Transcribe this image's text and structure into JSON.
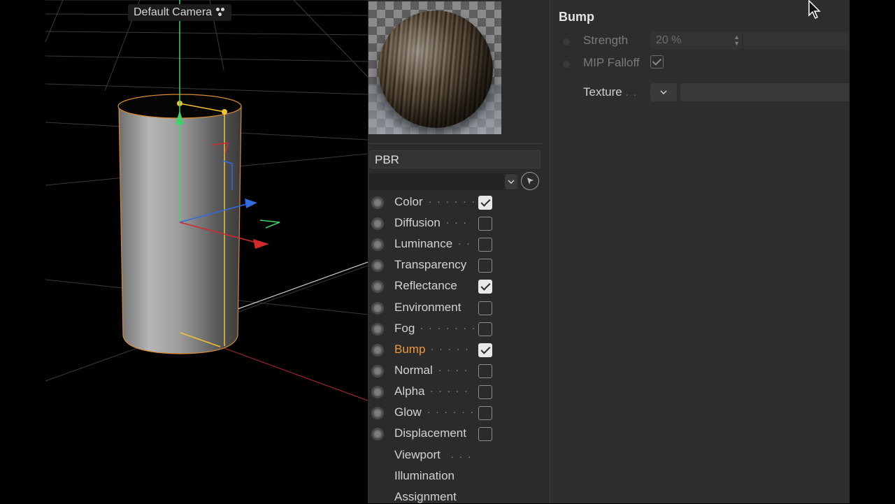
{
  "viewport": {
    "camera_label": "Default Camera"
  },
  "material": {
    "name": "PBR",
    "channels": [
      {
        "label": "Color",
        "checked": true,
        "dots": ". . . . . ."
      },
      {
        "label": "Diffusion",
        "checked": false,
        "dots": ". . ."
      },
      {
        "label": "Luminance",
        "checked": false,
        "dots": ". ."
      },
      {
        "label": "Transparency",
        "checked": false,
        "dots": ""
      },
      {
        "label": "Reflectance",
        "checked": true,
        "dots": ""
      },
      {
        "label": "Environment",
        "checked": false,
        "dots": ""
      },
      {
        "label": "Fog",
        "checked": false,
        "dots": ". . . . . . ."
      },
      {
        "label": "Bump",
        "checked": true,
        "dots": ". . . . . .",
        "active": true
      },
      {
        "label": "Normal",
        "checked": false,
        "dots": ". . . . ."
      },
      {
        "label": "Alpha",
        "checked": false,
        "dots": ". . . . . ."
      },
      {
        "label": "Glow",
        "checked": false,
        "dots": ". . . . . . ."
      },
      {
        "label": "Displacement",
        "checked": false,
        "dots": ""
      }
    ],
    "extra_items": [
      {
        "label": "Viewport",
        "dots": ". . ."
      },
      {
        "label": "Illumination",
        "dots": ""
      },
      {
        "label": "Assignment",
        "dots": ""
      }
    ]
  },
  "attributes": {
    "section_title": "Bump",
    "strength_label": "Strength",
    "strength_value": "20 %",
    "mip_falloff_label": "MIP Falloff",
    "mip_falloff_checked": true,
    "texture_label": "Texture",
    "texture_dots": ". ."
  },
  "colors": {
    "active_channel": "#ef9a3f",
    "panel_bg": "#2b2b2b",
    "viewport_bg": "#000000",
    "selection_outline": "#f0a030"
  }
}
